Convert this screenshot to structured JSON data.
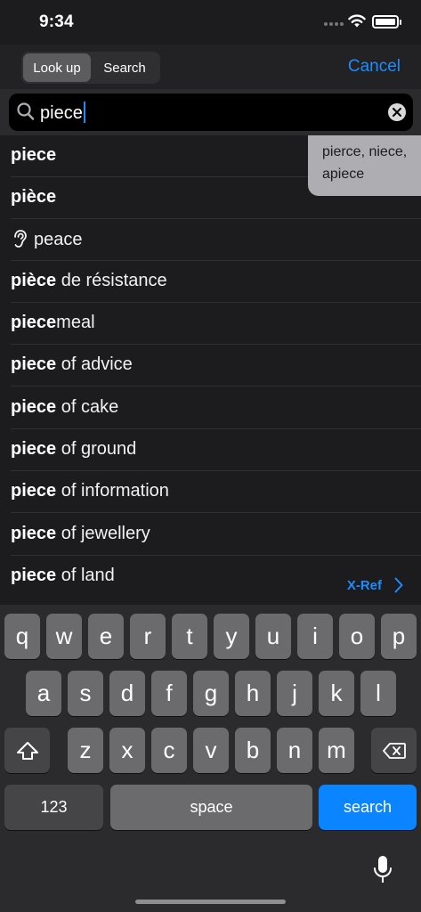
{
  "status": {
    "time": "9:34"
  },
  "topbar": {
    "segments": [
      "Look up",
      "Search"
    ],
    "active_segment": "Look up",
    "cancel_label": "Cancel"
  },
  "search": {
    "value": "piece"
  },
  "results": [
    {
      "bold": "piece",
      "rest": ""
    },
    {
      "bold": "pièce",
      "rest": ""
    },
    {
      "bold": "",
      "rest": "peace",
      "icon": "ear-icon"
    },
    {
      "bold": "pièce",
      "rest": " de résistance"
    },
    {
      "bold": "piece",
      "rest": "meal"
    },
    {
      "bold": "piece",
      "rest": " of advice"
    },
    {
      "bold": "piece",
      "rest": " of cake"
    },
    {
      "bold": "piece",
      "rest": " of ground"
    },
    {
      "bold": "piece",
      "rest": " of information"
    },
    {
      "bold": "piece",
      "rest": " of jewellery"
    },
    {
      "bold": "piece",
      "rest": " of land"
    }
  ],
  "suggestions": {
    "line1": "pierce, niece,",
    "line2": "apiece"
  },
  "xref": {
    "label": "X-Ref"
  },
  "keyboard": {
    "row1": [
      "q",
      "w",
      "e",
      "r",
      "t",
      "y",
      "u",
      "i",
      "o",
      "p"
    ],
    "row2": [
      "a",
      "s",
      "d",
      "f",
      "g",
      "h",
      "j",
      "k",
      "l"
    ],
    "row3": [
      "z",
      "x",
      "c",
      "v",
      "b",
      "n",
      "m"
    ],
    "numbers_label": "123",
    "space_label": "space",
    "search_label": "search"
  },
  "colors": {
    "accent": "#1e8cff",
    "search_key": "#0a84ff",
    "background": "#1c1c1e"
  }
}
